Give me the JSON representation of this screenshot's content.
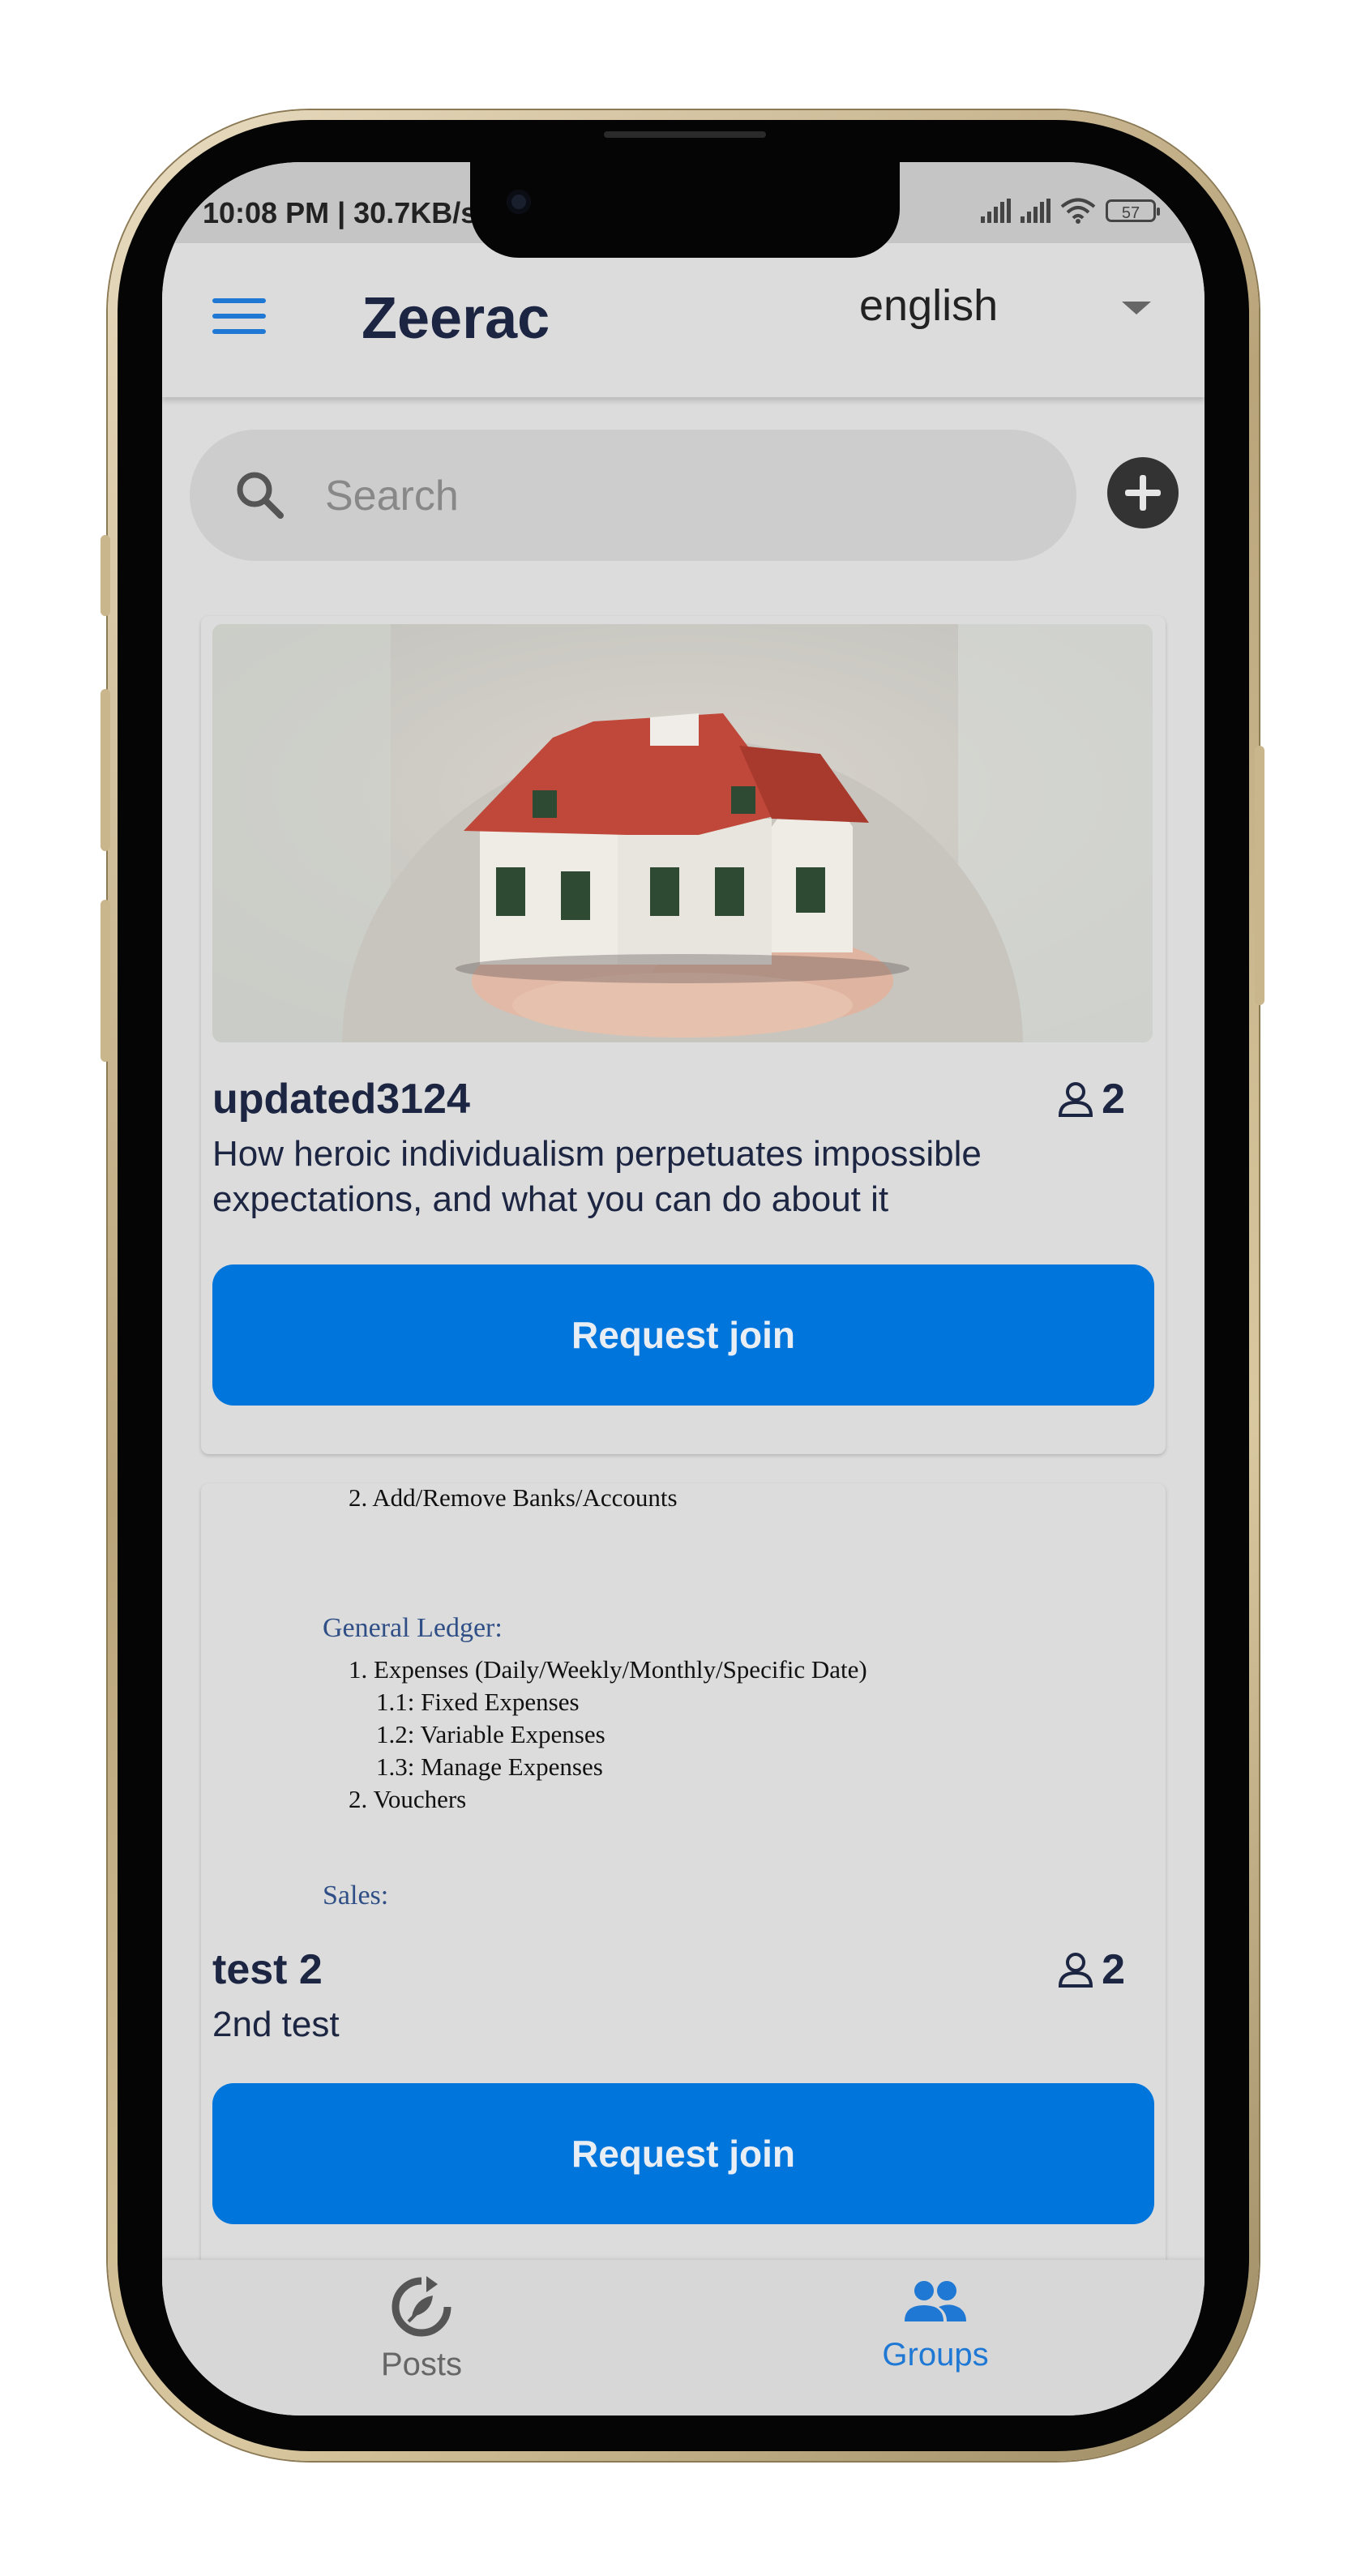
{
  "status_bar": {
    "time": "10:08 PM | 30.7KB/s",
    "battery": "57"
  },
  "app_bar": {
    "title": "Zeerac",
    "language": "english"
  },
  "search": {
    "placeholder": "Search"
  },
  "groups": [
    {
      "name": "updated3124",
      "members": "2",
      "description": "How heroic individualism perpetuates impossible expectations, and what you can do about it",
      "action_label": "Request join"
    },
    {
      "name": "test 2",
      "members": "2",
      "description": "2nd test",
      "action_label": "Request join",
      "preview": {
        "line_1": "2. Add/Remove Banks/Accounts",
        "heading_1": "General Ledger:",
        "line_2": "1. Expenses (Daily/Weekly/Monthly/Specific Date)",
        "line_3": "1.1: Fixed Expenses",
        "line_4": "1.2: Variable Expenses",
        "line_5": "1.3: Manage Expenses",
        "line_6": "2. Vouchers",
        "heading_2": "Sales:"
      }
    }
  ],
  "bottom_nav": {
    "posts": "Posts",
    "groups": "Groups"
  },
  "colors": {
    "accent": "#0075dc",
    "title_text": "#1c2541",
    "background": "#dcdcdc"
  },
  "icons": [
    "menu-icon",
    "search-icon",
    "add-icon",
    "person-icon",
    "posts-icon",
    "groups-icon"
  ]
}
